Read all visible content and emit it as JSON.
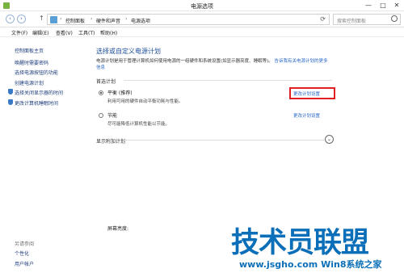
{
  "window": {
    "title": "电源选项",
    "minimize": "—",
    "maximize": "□",
    "close": "✕"
  },
  "address": {
    "back": "‹",
    "forward": "›",
    "up": "↑",
    "crumbs": [
      "控制面板",
      "硬件和声音",
      "电源选项"
    ],
    "separator": "›",
    "search_placeholder": "搜索控制面板"
  },
  "menu": [
    "文件(F)",
    "编辑(E)",
    "查看(V)",
    "工具(T)",
    "帮助(H)"
  ],
  "sidebar": {
    "home": "控制面板主页",
    "links": [
      "唤醒时需要密码",
      "选择电源按钮的功能",
      "创建电源计划",
      "选择关闭显示器的时间",
      "更改计算机睡眠时间"
    ],
    "see_also": "另请参阅",
    "see_also_links": [
      "个性化",
      "用户帐户"
    ]
  },
  "main": {
    "heading": "选择或自定义电源计划",
    "description_line1": "电源计划是用于管理计算机如何使用电源的一组硬件和系统设置(如显示器亮度、睡眠等)。",
    "description_link1": "告诉我有关电源计划",
    "description_link2": "的更多信息",
    "section_preferred": "首选计划",
    "plans": [
      {
        "name": "平衡 (推荐)",
        "description": "利用可用的硬件自动平衡功耗与性能。",
        "link": "更改计划设置",
        "selected": true
      },
      {
        "name": "节能",
        "description": "尽可能降低计算机性能以节能。",
        "link": "更改计划设置",
        "selected": false
      }
    ],
    "more_plans": "显示附加计划",
    "expand_icon": "⌄",
    "bottom_label": "屏幕亮度:"
  },
  "watermark": {
    "big": "技术员联盟",
    "small": "www.jsgho.com  Win8系统之家"
  },
  "colors": {
    "link": "#2a67c7",
    "heading": "#1e4f9c",
    "highlight": "#e02020",
    "watermark": "#0a6fb8"
  }
}
